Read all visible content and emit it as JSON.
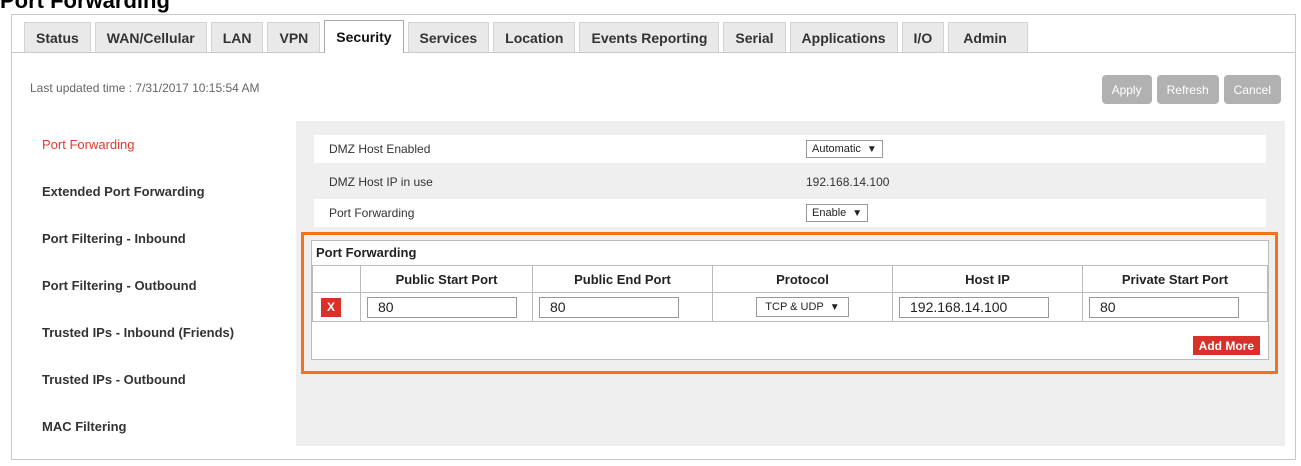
{
  "page_heading_cut": "Port Forwarding",
  "tabs": [
    {
      "label": "Status"
    },
    {
      "label": "WAN/Cellular"
    },
    {
      "label": "LAN"
    },
    {
      "label": "VPN"
    },
    {
      "label": "Security"
    },
    {
      "label": "Services"
    },
    {
      "label": "Location"
    },
    {
      "label": "Events Reporting"
    },
    {
      "label": "Serial"
    },
    {
      "label": "Applications"
    },
    {
      "label": "I/O"
    },
    {
      "label": "Admin"
    }
  ],
  "active_tab": "Security",
  "last_updated": "Last updated time : 7/31/2017 10:15:54 AM",
  "buttons": {
    "apply": "Apply",
    "refresh": "Refresh",
    "cancel": "Cancel"
  },
  "sidebar": {
    "items": [
      {
        "label": "Port Forwarding"
      },
      {
        "label": "Extended Port Forwarding"
      },
      {
        "label": "Port Filtering - Inbound"
      },
      {
        "label": "Port Filtering - Outbound"
      },
      {
        "label": "Trusted IPs - Inbound (Friends)"
      },
      {
        "label": "Trusted IPs - Outbound"
      },
      {
        "label": "MAC Filtering"
      }
    ],
    "active": "Port Forwarding"
  },
  "settings": {
    "dmz_enabled_label": "DMZ Host Enabled",
    "dmz_enabled_value": "Automatic",
    "dmz_ip_label": "DMZ Host IP in use",
    "dmz_ip_value": "192.168.14.100",
    "pf_label": "Port Forwarding",
    "pf_value": "Enable"
  },
  "port_forwarding": {
    "title": "Port Forwarding",
    "columns": [
      "Public Start Port",
      "Public End Port",
      "Protocol",
      "Host IP",
      "Private Start Port"
    ],
    "rows": [
      {
        "public_start": "80",
        "public_end": "80",
        "protocol": "TCP & UDP",
        "host_ip": "192.168.14.100",
        "private_start": "80"
      }
    ],
    "add_more": "Add More",
    "delete_glyph": "X"
  },
  "colors": {
    "accent_red": "#d9302a",
    "highlight_orange": "#f07320",
    "active_link": "#e23a2e"
  }
}
